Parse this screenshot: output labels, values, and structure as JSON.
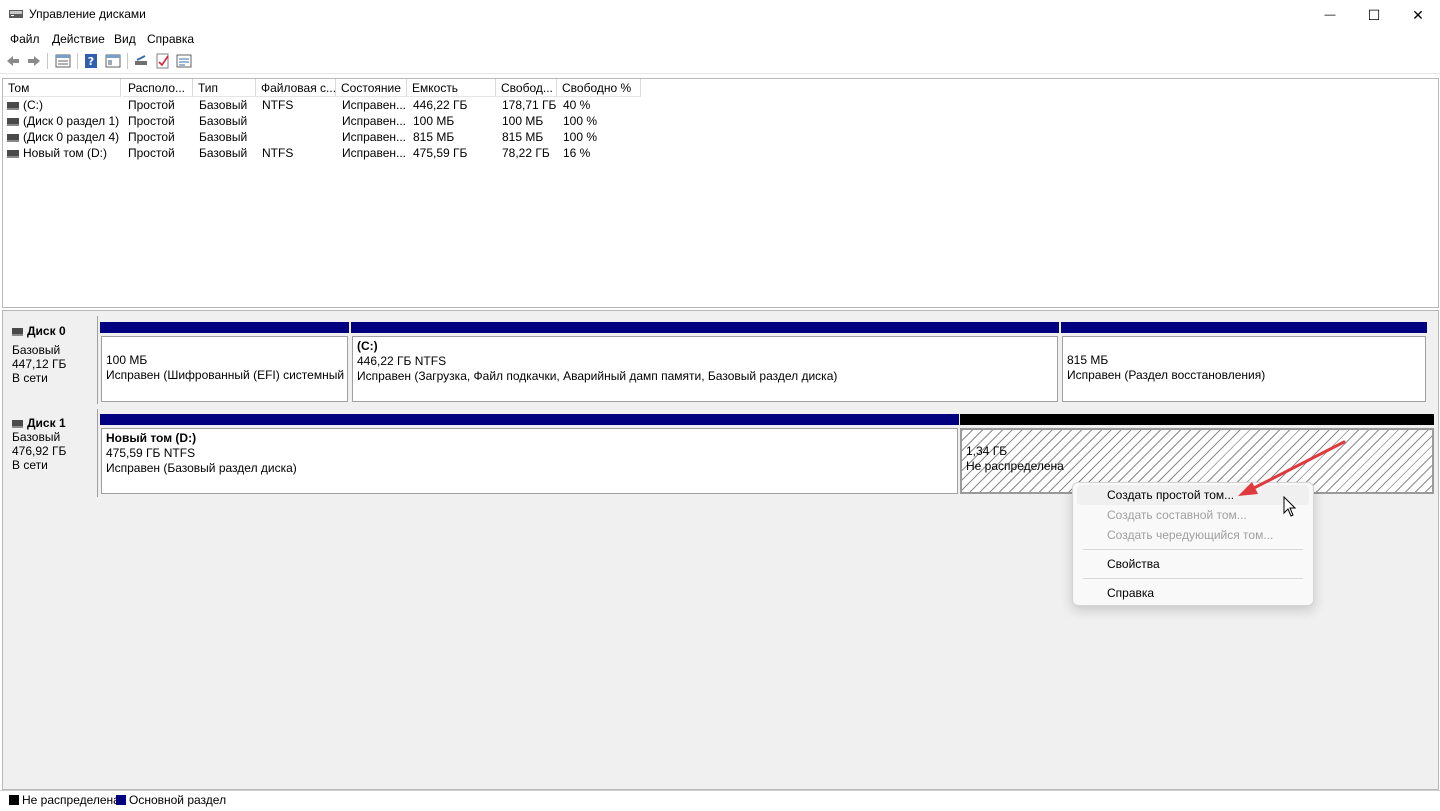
{
  "window": {
    "title": "Управление дисками",
    "minimize_glyph": "—",
    "maximize_glyph": "☐",
    "close_glyph": "✕"
  },
  "menu": [
    "Файл",
    "Действие",
    "Вид",
    "Справка"
  ],
  "toolbar": {
    "icons": [
      "back-icon",
      "forward-icon",
      "properties-list-icon",
      "help-icon",
      "show-hide-icon",
      "refresh-icon",
      "check-disk-icon",
      "settings-icon"
    ]
  },
  "volume_list": {
    "columns": [
      "Том",
      "Располо...",
      "Тип",
      "Файловая с...",
      "Состояние",
      "Емкость",
      "Свобод...",
      "Свободно %"
    ],
    "rows": [
      [
        "(C:)",
        "Простой",
        "Базовый",
        "NTFS",
        "Исправен...",
        "446,22 ГБ",
        "178,71 ГБ",
        "40 %"
      ],
      [
        "(Диск 0 раздел 1)",
        "Простой",
        "Базовый",
        "",
        "Исправен...",
        "100 МБ",
        "100 МБ",
        "100 %"
      ],
      [
        "(Диск 0 раздел 4)",
        "Простой",
        "Базовый",
        "",
        "Исправен...",
        "815 МБ",
        "815 МБ",
        "100 %"
      ],
      [
        "Новый том (D:)",
        "Простой",
        "Базовый",
        "NTFS",
        "Исправен...",
        "475,59 ГБ",
        "78,22 ГБ",
        "16 %"
      ]
    ]
  },
  "disks": [
    {
      "name": "Диск 0",
      "type": "Базовый",
      "size": "447,12 ГБ",
      "status": "В сети",
      "partitions": [
        {
          "label": "",
          "size": "100 МБ",
          "status": "Исправен (Шифрованный (EFI) системный раз"
        },
        {
          "label": "(C:)",
          "size": "446,22 ГБ NTFS",
          "status": "Исправен (Загрузка, Файл подкачки, Аварийный дамп памяти, Базовый раздел диска)"
        },
        {
          "label": "",
          "size": "815 МБ",
          "status": "Исправен (Раздел восстановления)"
        }
      ]
    },
    {
      "name": "Диск 1",
      "type": "Базовый",
      "size": "476,92 ГБ",
      "status": "В сети",
      "partitions": [
        {
          "label": "Новый том  (D:)",
          "size": "475,59 ГБ NTFS",
          "status": "Исправен (Базовый раздел диска)"
        },
        {
          "label": "",
          "size": "1,34 ГБ",
          "status": "Не распределена"
        }
      ]
    }
  ],
  "context_menu": {
    "items": [
      {
        "label": "Создать простой том...",
        "enabled": true
      },
      {
        "label": "Создать составной том...",
        "enabled": false
      },
      {
        "label": "Создать чередующийся том...",
        "enabled": false
      },
      {
        "label": "Свойства",
        "enabled": true
      },
      {
        "label": "Справка",
        "enabled": true
      }
    ]
  },
  "legend": [
    {
      "label": "Не распределена",
      "color": "#000000"
    },
    {
      "label": "Основной раздел",
      "color": "#000080"
    }
  ],
  "colors": {
    "primary_partition": "#000080",
    "unallocated": "#000000",
    "annotation_arrow": "#e0393e"
  }
}
